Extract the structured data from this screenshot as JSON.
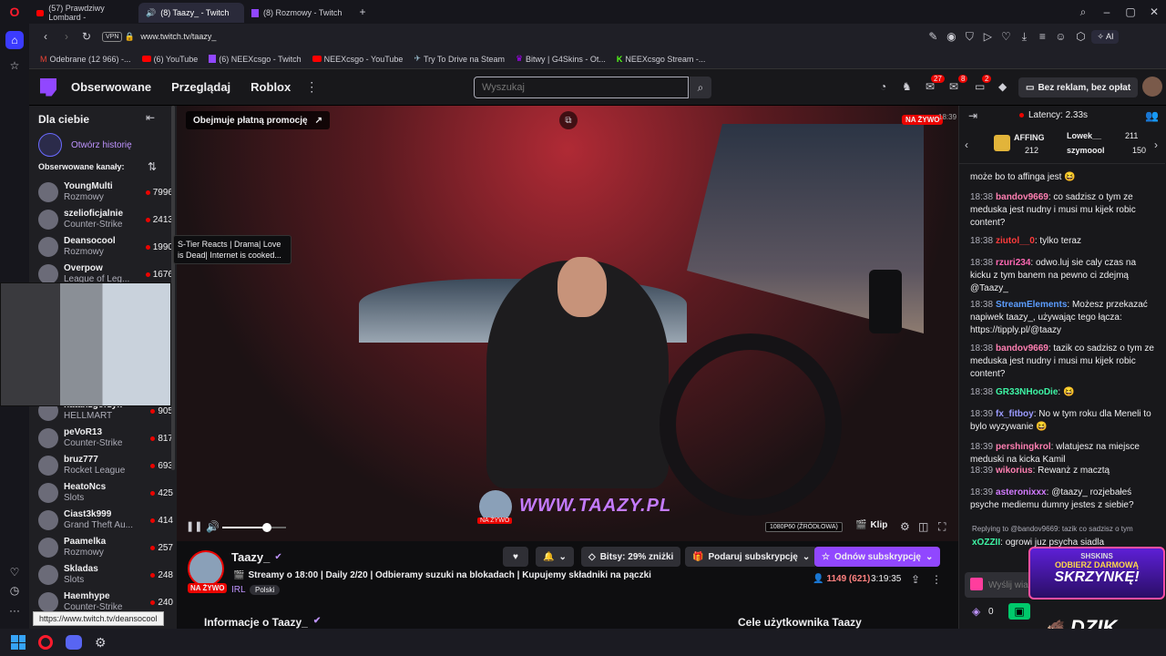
{
  "browser": {
    "tabs": [
      {
        "label": "(57) Prawdziwy Lombard -",
        "active": false
      },
      {
        "label": "(8) Taazy_ - Twitch",
        "active": true
      },
      {
        "label": "(8) Rozmowy - Twitch",
        "active": false
      }
    ],
    "vpn": "VPN",
    "url": "www.twitch.tv/taazy_",
    "ai": "AI",
    "bookmarks": [
      "Odebrane (12 966) -...",
      "(6) YouTube",
      "(6) NEEXcsgo - Twitch",
      "NEEXcsgo - YouTube",
      "Try To Drive na Steam",
      "Bitwy | G4Skins - Ot...",
      "NEEXcsgo Stream -..."
    ],
    "status_url": "https://www.twitch.tv/deansocool"
  },
  "twitch_nav": {
    "followed": "Obserwowane",
    "browse": "Przeglądaj",
    "roblox": "Roblox",
    "search_placeholder": "Wyszukaj",
    "badge_inbox": "27",
    "badge_notif": "8",
    "badge_whisper": "2",
    "ad_free": "Bez reklam, bez opłat"
  },
  "sidebar": {
    "title": "Dla ciebie",
    "history": "Otwórz historię",
    "followed_title": "Obserwowane kanały:",
    "tooltip": "S-Tier Reacts | Drama| Love is Dead| Internet is cooked...",
    "channels": [
      {
        "name": "YoungMulti",
        "cat": "Rozmowy",
        "viewers": "7996"
      },
      {
        "name": "szelioficjalnie",
        "cat": "Counter-Strike",
        "viewers": "2413"
      },
      {
        "name": "Deansocool",
        "cat": "Rozmowy",
        "viewers": "1990"
      },
      {
        "name": "Overpow",
        "cat": "League of Leg...",
        "viewers": "1676"
      },
      {
        "name": "natanzgorzyk",
        "cat": "HELLMART",
        "viewers": "905"
      },
      {
        "name": "peVoR13",
        "cat": "Counter-Strike",
        "viewers": "817"
      },
      {
        "name": "bruz777",
        "cat": "Rocket League",
        "viewers": "693"
      },
      {
        "name": "HeatoNcs",
        "cat": "Slots",
        "viewers": "425"
      },
      {
        "name": "Ciast3k999",
        "cat": "Grand Theft Au...",
        "viewers": "414"
      },
      {
        "name": "Paamelka",
        "cat": "Rozmowy",
        "viewers": "257"
      },
      {
        "name": "Skladas",
        "cat": "Slots",
        "viewers": "248"
      },
      {
        "name": "Haemhype",
        "cat": "Counter-Strike",
        "viewers": "240"
      }
    ]
  },
  "video": {
    "promo": "Obejmuje płatną promocję",
    "live": "NA ŻYWO",
    "watermark": "WWW.TAAZY.PL",
    "watermark_live": "NA ŻYWO",
    "timestamp": "18:39",
    "quality": "1080P60 (ŹRÓDŁOWA)",
    "clip": "Klip",
    "volume": 0.7
  },
  "stream_info": {
    "name": "Taazy_",
    "live": "NA ŻYWO",
    "title": "Streamy o 18:00 | Daily 2/20 | Odbieramy suzuki na blokadach | Kupujemy składniki na pączki",
    "category": "IRL",
    "tag": "Polski",
    "bits": "Bitsy: 29% zniżki",
    "gift": "Podaruj subskrypcję",
    "resub": "Odnów subskrypcję",
    "viewers": "1149 (621)",
    "uptime": "3:19:35",
    "about": "Informacje o Taazy_",
    "goals": "Cele użytkownika Taazy"
  },
  "chat": {
    "latency": "Latency: 2.33s",
    "gifters": [
      {
        "name": "AFFING",
        "count": "212"
      },
      {
        "name": "Lowek__",
        "count": "211"
      },
      {
        "name": "szymoool",
        "count": "150"
      }
    ],
    "messages": [
      {
        "time": "",
        "user": "",
        "color": "#efeff1",
        "text": "może bo to affinga jest 😆"
      },
      {
        "time": "18:38",
        "user": "bandov9669",
        "color": "#ff7fb2",
        "text": "co sadzisz o tym ze meduska jest nudny i musi mu kijek robic content?"
      },
      {
        "time": "18:38",
        "user": "ziutol__0",
        "color": "#ff3b3b",
        "text": "tylko teraz"
      },
      {
        "time": "18:38",
        "user": "rzuri234",
        "color": "#ff69b4",
        "text": "odwo.luj sie caly czas na kicku z tym banem na pewno ci zdejmą @Taazy_"
      },
      {
        "time": "18:38",
        "user": "StreamElements",
        "color": "#5c9dff",
        "text": "Możesz przekazać napiwek taazy_, używając tego łącza: https://tipply.pl/@taazy"
      },
      {
        "time": "18:38",
        "user": "bandov9669",
        "color": "#ff7fb2",
        "text": "tazik co sadzisz o tym ze meduska jest nudny i musi mu kijek robic content?"
      },
      {
        "time": "18:38",
        "user": "GR33NHooDie",
        "color": "#3ef5a5",
        "text": "😆"
      },
      {
        "time": "18:39",
        "user": "fx_fitboy",
        "color": "#9b9bff",
        "text": "No w tym roku dla Meneli to bylo wyzywanie 😆"
      },
      {
        "time": "18:39",
        "user": "pershingkrol",
        "color": "#ff7fb2",
        "text": "wlatujesz na miejsce meduski na kicka Kamil"
      },
      {
        "time": "18:39",
        "user": "wikorius",
        "color": "#ff7fb2",
        "text": "Rewanż z macztą"
      },
      {
        "time": "18:39",
        "user": "asteronixxx",
        "color": "#d27bff",
        "text": "@taazy_ rozjebałeś psyche mediemu dumny jestes z siebie?"
      }
    ],
    "reply": "Replying to @bandov9669: tazik co sadzisz o tym",
    "last_user": "xOZZII",
    "last_text": "ogrowi juz psycha siadla",
    "input_placeholder": "Wyślij wia...",
    "points": "0",
    "promo_brand": "SHSKINS",
    "promo_line1": "ODBIERZ DARMOWĄ",
    "promo_line2": "SKRZYNKĘ!",
    "dzik": "DZIK"
  }
}
